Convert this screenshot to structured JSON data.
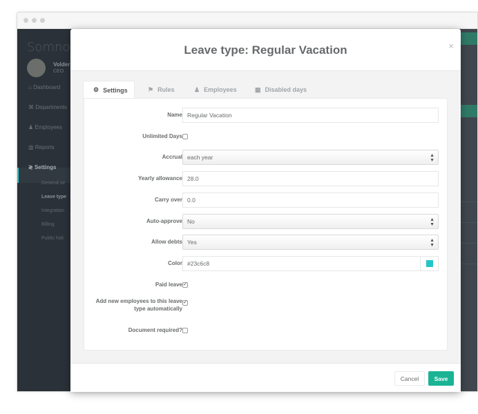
{
  "background_app": {
    "brand": "Somno",
    "user": {
      "name": "Volder",
      "role": "CEO"
    },
    "nav": [
      {
        "label": "Dashboard",
        "icon": "home-icon"
      },
      {
        "label": "Departments",
        "icon": "department-icon"
      },
      {
        "label": "Employees",
        "icon": "user-icon"
      },
      {
        "label": "Reports",
        "icon": "chart-icon"
      },
      {
        "label": "Settings",
        "icon": "sliders-icon",
        "active": true
      }
    ],
    "settings_sub": [
      {
        "label": "General se"
      },
      {
        "label": "Leave type",
        "active": true
      },
      {
        "label": "Integration"
      },
      {
        "label": "Billing"
      },
      {
        "label": "Public holi"
      }
    ]
  },
  "modal": {
    "title": "Leave type: Regular Vacation",
    "close_label": "×",
    "tabs": [
      {
        "label": "Settings",
        "icon": "gear-icon",
        "active": true
      },
      {
        "label": "Rules",
        "icon": "flag-icon"
      },
      {
        "label": "Employees",
        "icon": "user-icon"
      },
      {
        "label": "Disabled days",
        "icon": "calendar-icon"
      }
    ],
    "form": {
      "name": {
        "label": "Name",
        "value": "Regular Vacation"
      },
      "unlimited_days": {
        "label": "Unlimited Days",
        "checked": false
      },
      "accrual": {
        "label": "Accrual",
        "value": "each year"
      },
      "yearly_allowance": {
        "label": "Yearly allowance",
        "value": "28.0"
      },
      "carry_over": {
        "label": "Carry over",
        "value": "0.0"
      },
      "auto_approve": {
        "label": "Auto-approve",
        "value": "No"
      },
      "allow_debts": {
        "label": "Allow debts",
        "value": "Yes"
      },
      "color": {
        "label": "Color",
        "value": "#23c6c8",
        "swatch": "#23c6c8"
      },
      "paid_leave": {
        "label": "Paid leave",
        "checked": true,
        "mark": "✓"
      },
      "auto_add": {
        "label": "Add new employees to this leave type automatically",
        "checked": true,
        "mark": "✓"
      },
      "document_required": {
        "label": "Document required?",
        "checked": false
      }
    },
    "footer": {
      "cancel_label": "Cancel",
      "save_label": "Save"
    }
  },
  "colors": {
    "accent": "#1ab394",
    "swatch": "#23c6c8",
    "sidebar": "#2a3138"
  }
}
